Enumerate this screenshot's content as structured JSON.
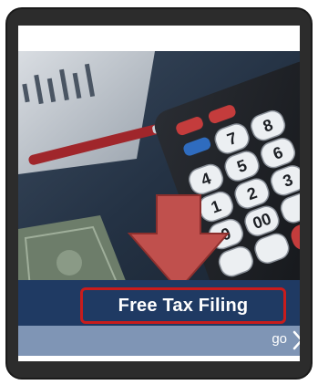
{
  "card": {
    "title": "Free Tax Filing",
    "go_label": "go"
  },
  "colors": {
    "frame": "#2c2c2c",
    "title_bar": "#1f3a63",
    "go_bar": "#7f95b5",
    "highlight_outline": "#c81c1c",
    "arrow": "#c0504d"
  },
  "icons": {
    "pointer_arrow": "down-arrow-icon",
    "go_chevron": "chevron-right-icon"
  }
}
